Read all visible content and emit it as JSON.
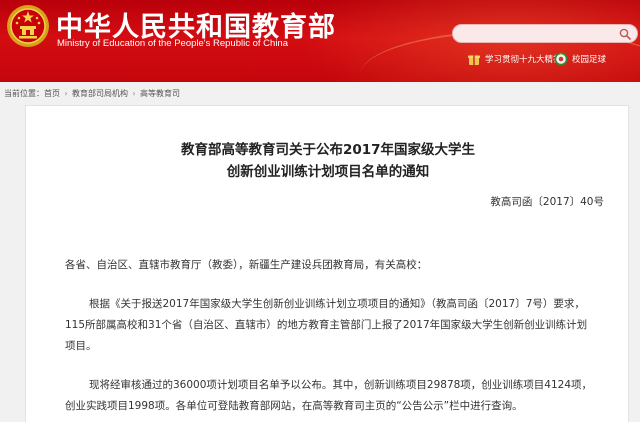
{
  "header": {
    "title": "中华人民共和国教育部",
    "subtitle": "Ministry of Education of the People's Republic of China",
    "emblem_icon": "national-emblem-icon",
    "search": {
      "placeholder": "",
      "value": ""
    },
    "quicklinks": [
      {
        "label": "学习贯彻十九大精神",
        "icon": "gift-icon"
      },
      {
        "label": "校园足球",
        "icon": "football-emblem-icon"
      }
    ],
    "colors": {
      "primary": "#c4060c",
      "text": "#ffffff"
    }
  },
  "breadcrumb": {
    "prefix": "当前位置：",
    "items": [
      "首页",
      "教育部司局机构",
      "高等教育司"
    ]
  },
  "document": {
    "title_line1": "教育部高等教育司关于公布2017年国家级大学生",
    "title_line2": "创新创业训练计划项目名单的通知",
    "number": "教高司函〔2017〕40号",
    "salutation": "各省、自治区、直辖市教育厅（教委），新疆生产建设兵团教育局，有关高校：",
    "paragraph1": [
      "根据《关于报送2017年国家级大学生创新创业训练计划立项项目的通知》（教高司函〔2017〕7号）要求，",
      "115所部属高校和31个省（自治区、直辖市）的地方教育主管部门上报了2017年国家级大学生创新创业训练计划",
      "项目。"
    ],
    "paragraph2": [
      "现将经审核通过的36000项计划项目名单予以公布。其中，创新训练项目29878项，创业训练项目4124项，",
      "创业实践项目1998项。各单位可登陆教育部网站，在高等教育司主页的“公告公示”栏中进行查询。"
    ]
  }
}
